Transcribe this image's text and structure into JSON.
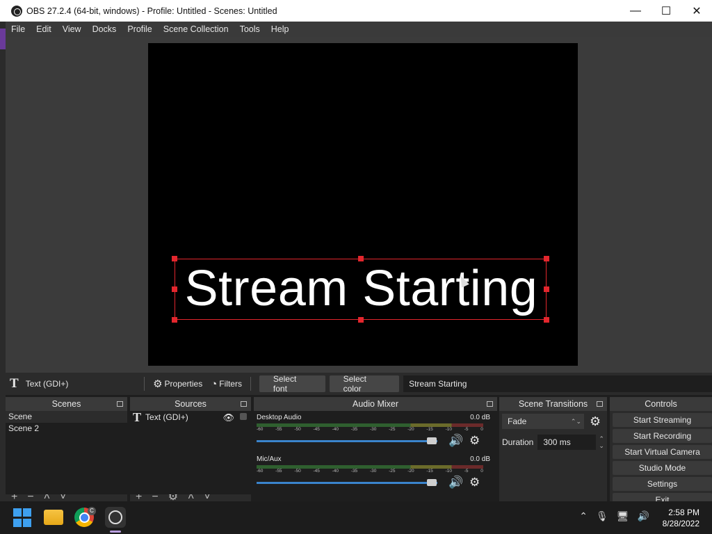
{
  "window": {
    "title": "OBS 27.2.4 (64-bit, windows) - Profile: Untitled - Scenes: Untitled",
    "minimize": "—",
    "maximize": "☐",
    "close": "✕"
  },
  "menu": [
    "File",
    "Edit",
    "View",
    "Docks",
    "Profile",
    "Scene Collection",
    "Tools",
    "Help"
  ],
  "preview": {
    "text": "Stream Starting"
  },
  "context_bar": {
    "source_icon": "T",
    "source_name": "Text (GDI+)",
    "properties": "Properties",
    "filters": "Filters",
    "select_font": "Select font",
    "select_color": "Select color",
    "text_value": "Stream Starting"
  },
  "scenes": {
    "title": "Scenes",
    "items": [
      "Scene",
      "Scene 2"
    ]
  },
  "sources": {
    "title": "Sources",
    "items": [
      {
        "icon": "T",
        "name": "Text (GDI+)"
      }
    ]
  },
  "audio_mixer": {
    "title": "Audio Mixer",
    "ticks": [
      "-60",
      "-55",
      "-50",
      "-45",
      "-40",
      "-35",
      "-30",
      "-25",
      "-20",
      "-15",
      "-10",
      "-5",
      "0"
    ],
    "tracks": [
      {
        "name": "Desktop Audio",
        "db": "0.0 dB",
        "volume": 0.96
      },
      {
        "name": "Mic/Aux",
        "db": "0.0 dB",
        "volume": 0.96
      }
    ]
  },
  "transitions": {
    "title": "Scene Transitions",
    "selected": "Fade",
    "duration_label": "Duration",
    "duration_value": "300 ms"
  },
  "controls": {
    "title": "Controls",
    "buttons": [
      "Start Streaming",
      "Start Recording",
      "Start Virtual Camera",
      "Studio Mode",
      "Settings",
      "Exit"
    ]
  },
  "taskbar": {
    "time": "2:58 PM",
    "date": "8/28/2022",
    "chrome_badge": "C"
  },
  "colors": {
    "selection": "#e3262d",
    "volume_bar": "#3a84cc",
    "panel": "#2b2b2b",
    "background": "#1e1e1e"
  }
}
